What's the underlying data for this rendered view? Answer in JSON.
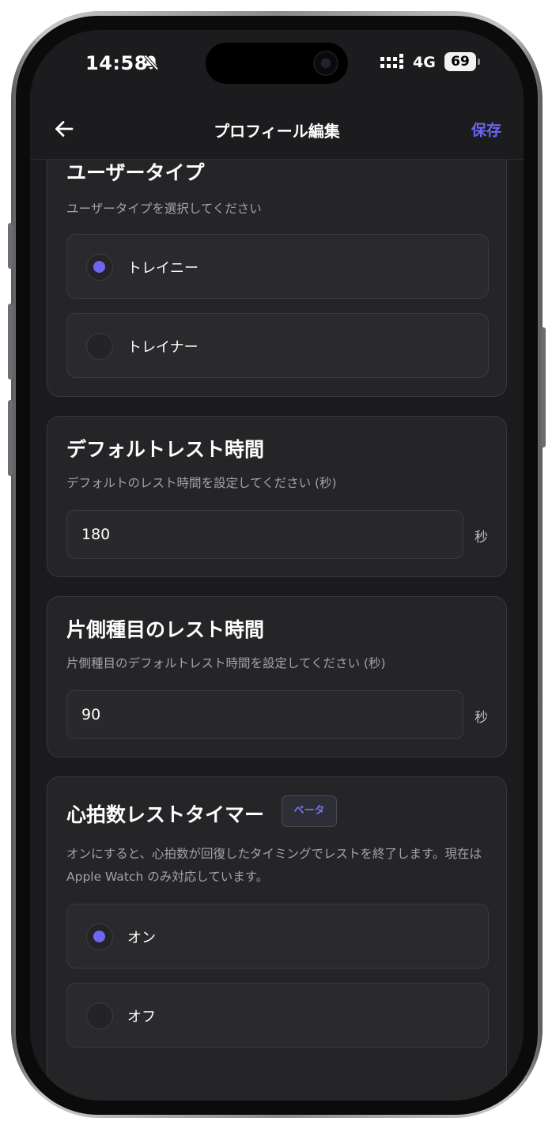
{
  "status_bar": {
    "time": "14:58",
    "network": "4G",
    "battery": "69"
  },
  "header": {
    "title": "プロフィール編集",
    "save_label": "保存"
  },
  "user_type": {
    "title": "ユーザータイプ",
    "description": "ユーザータイプを選択してください",
    "options": [
      {
        "label": "トレイニー",
        "selected": true
      },
      {
        "label": "トレイナー",
        "selected": false
      }
    ]
  },
  "default_rest": {
    "title": "デフォルトレスト時間",
    "description": "デフォルトのレスト時間を設定してください (秒)",
    "value": "180",
    "unit": "秒"
  },
  "unilateral_rest": {
    "title": "片側種目のレスト時間",
    "description": "片側種目のデフォルトレスト時間を設定してください (秒)",
    "value": "90",
    "unit": "秒"
  },
  "hr_timer": {
    "title": "心拍数レストタイマー",
    "badge": "ベータ",
    "description": "オンにすると、心拍数が回復したタイミングでレストを終了します。現在は Apple Watch のみ対応しています。",
    "options": [
      {
        "label": "オン",
        "selected": true
      },
      {
        "label": "オフ",
        "selected": false
      }
    ]
  },
  "colors": {
    "accent": "#6f67f2",
    "background": "#1b1b1d",
    "card": "#252527"
  }
}
